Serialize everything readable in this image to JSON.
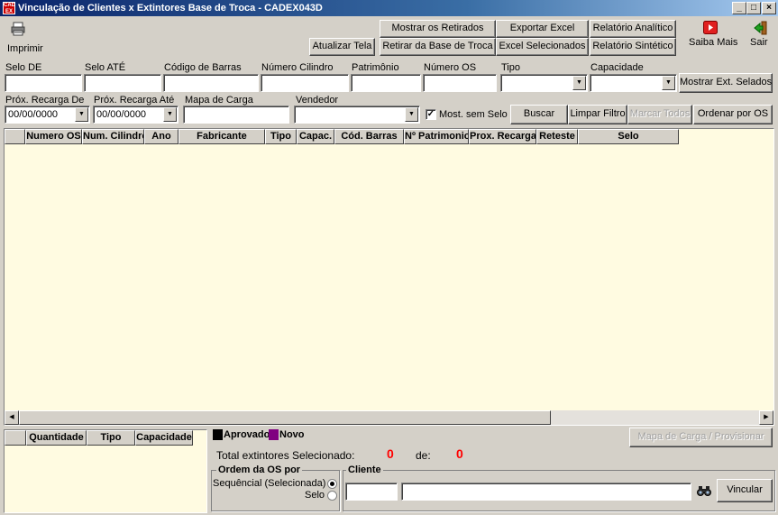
{
  "window": {
    "title": "Vinculação de Clientes x Extintores Base de Troca - CADEX043D",
    "icon_text": "CAD EX",
    "minimize": "_",
    "maximize": "□",
    "close": "×"
  },
  "toolbar": {
    "imprimir": "Imprimir",
    "atualizar_tela": "Atualizar Tela",
    "mostrar_retirados": "Mostrar os Retirados",
    "retirar_base": "Retirar da Base de Troca",
    "exportar_excel": "Exportar Excel",
    "excel_selecionados": "Excel Selecionados",
    "relatorio_analitico": "Relatório Analítico",
    "relatorio_sintetico": "Relatório Sintético",
    "saiba_mais": "Saiba Mais",
    "sair": "Sair"
  },
  "filters": {
    "selo_de": {
      "label": "Selo DE",
      "value": ""
    },
    "selo_ate": {
      "label": "Selo ATÉ",
      "value": ""
    },
    "codigo_barras": {
      "label": "Código de Barras",
      "value": ""
    },
    "numero_cilindro": {
      "label": "Número Cilindro",
      "value": ""
    },
    "patrimonio": {
      "label": "Patrimônio",
      "value": ""
    },
    "numero_os": {
      "label": "Número OS",
      "value": ""
    },
    "tipo": {
      "label": "Tipo",
      "value": ""
    },
    "capacidade": {
      "label": "Capacidade",
      "value": ""
    },
    "mostrar_ext_selados": "Mostrar Ext. Selados",
    "prox_recarga_de": {
      "label": "Próx. Recarga De",
      "value": "00/00/0000"
    },
    "prox_recarga_ate": {
      "label": "Próx. Recarga Até",
      "value": "00/00/0000"
    },
    "mapa_carga": {
      "label": "Mapa de Carga",
      "value": ""
    },
    "vendedor": {
      "label": "Vendedor",
      "value": ""
    },
    "most_sem_selo": {
      "label": "Most. sem Selo",
      "checked": true,
      "mark": "✓"
    },
    "buscar": "Buscar",
    "limpar_filtro": "Limpar Filtro",
    "marcar_todos": "Marcar Todos",
    "ordenar_por_os": "Ordenar por OS"
  },
  "grid": {
    "columns": [
      "",
      "Numero OS",
      "Num. Cilindro",
      "Ano",
      "Fabricante",
      "Tipo",
      "Capac.",
      "Cód. Barras",
      "Nº Patrimonio",
      "Prox. Recarga",
      "Reteste",
      "Selo"
    ],
    "rows": []
  },
  "summary_grid": {
    "columns": [
      "",
      "Quantidade",
      "Tipo",
      "Capacidade"
    ],
    "rows": []
  },
  "legend": {
    "aprovado": {
      "label": "Aprovado",
      "color": "#000000"
    },
    "novo": {
      "label": "Novo",
      "color": "#800080"
    }
  },
  "totals": {
    "label": "Total extintores Selecionado:",
    "selected": "0",
    "de_label": "de:",
    "total": "0",
    "value_color": "#ff0000"
  },
  "mapa_carga_button": "Mapa de Carga / Provisionar",
  "ordem_os": {
    "title": "Ordem da OS por",
    "sequencial": {
      "label": "Sequêncial (Selecionada)",
      "selected": true
    },
    "selo": {
      "label": "Selo",
      "selected": false
    }
  },
  "cliente": {
    "title": "Cliente",
    "code": "",
    "name": "",
    "vincular": "Vincular"
  }
}
